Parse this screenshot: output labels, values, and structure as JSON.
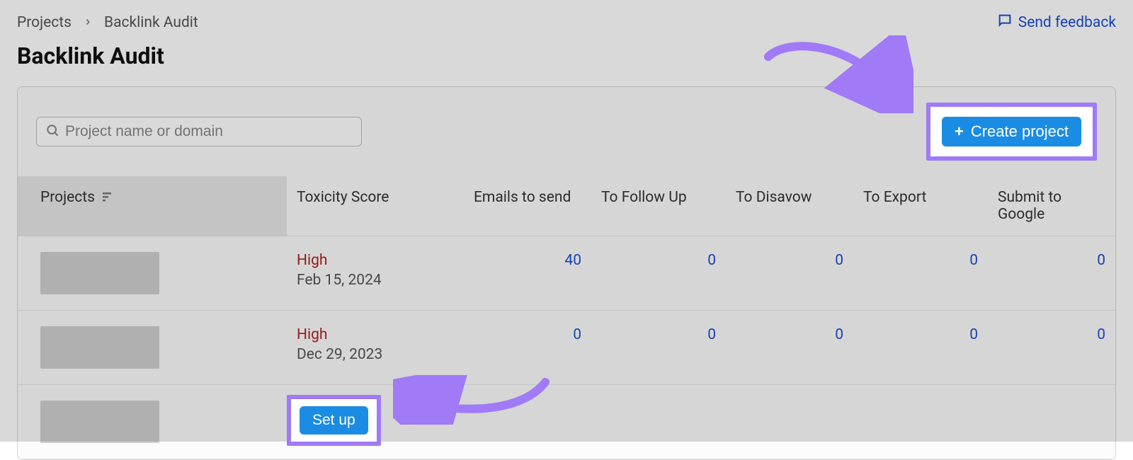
{
  "breadcrumb": {
    "root": "Projects",
    "current": "Backlink Audit"
  },
  "feedback": {
    "label": "Send feedback"
  },
  "page_title": "Backlink Audit",
  "search": {
    "placeholder": "Project name or domain"
  },
  "create_button": {
    "label": "Create project"
  },
  "setup_button": {
    "label": "Set up"
  },
  "columns": {
    "projects": "Projects",
    "toxicity": "Toxicity Score",
    "emails": "Emails to send",
    "followup": "To Follow Up",
    "disavow": "To Disavow",
    "export": "To Export",
    "submit": "Submit to Google"
  },
  "rows": [
    {
      "toxicity_level": "High",
      "toxicity_date": "Feb 15, 2024",
      "emails": "40",
      "followup": "0",
      "disavow": "0",
      "export": "0",
      "submit": "0"
    },
    {
      "toxicity_level": "High",
      "toxicity_date": "Dec 29, 2023",
      "emails": "0",
      "followup": "0",
      "disavow": "0",
      "export": "0",
      "submit": "0"
    }
  ],
  "colors": {
    "accent_purple": "#a07af7",
    "primary_blue": "#1b8ce3",
    "link_blue": "#1a4fcf",
    "danger_red": "#b02323"
  }
}
